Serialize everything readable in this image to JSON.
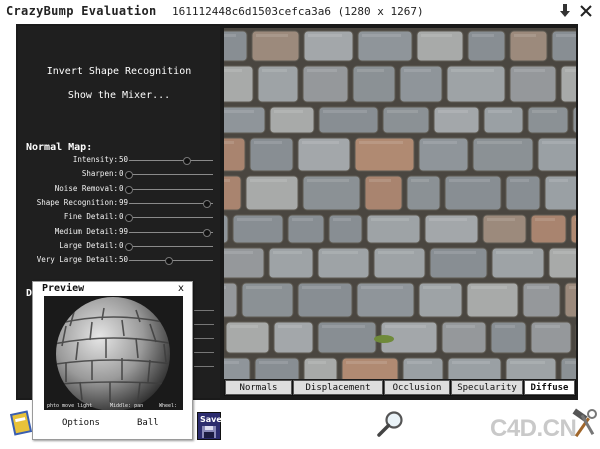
{
  "title_bar": {
    "app_title": "CrazyBump Evaluation",
    "file_info": "161112448c6d1503cefca3a6 (1280 x 1267)",
    "icons": [
      "download-arrow-icon",
      "close-icon"
    ]
  },
  "left_panel": {
    "commands": [
      "Invert Shape Recognition",
      "Show the Mixer..."
    ],
    "normal_map": {
      "heading": "Normal Map:",
      "sliders": [
        {
          "label": "Intensity:",
          "value": "50",
          "level": 0.72
        },
        {
          "label": "Sharpen:",
          "value": "0",
          "level": 0.0
        },
        {
          "label": "Noise Removal:",
          "value": "0",
          "level": 0.0
        },
        {
          "label": "Shape Recognition:",
          "value": "99",
          "level": 0.97
        },
        {
          "label": "Fine Detail:",
          "value": "0",
          "level": 0.0
        },
        {
          "label": "Medium Detail:",
          "value": "99",
          "level": 0.97
        },
        {
          "label": "Large Detail:",
          "value": "0",
          "level": 0.0
        },
        {
          "label": "Very Large Detail:",
          "value": "50",
          "level": 0.5
        }
      ]
    },
    "partial_heading": "D"
  },
  "tabs": [
    {
      "label": "Normals",
      "active": false
    },
    {
      "label": "Displacement",
      "active": false
    },
    {
      "label": "Occlusion",
      "active": false
    },
    {
      "label": "Specularity",
      "active": false
    },
    {
      "label": "Diffuse",
      "active": true
    }
  ],
  "preview": {
    "title": "Preview",
    "close": "x",
    "hints": [
      "phto move light",
      "Middle: pan",
      "Wheel:"
    ],
    "buttons": [
      "Options",
      "Ball"
    ]
  },
  "save_button": {
    "label": "Save"
  },
  "magnifier": {
    "icon": "magnifier-icon"
  },
  "tools": {
    "icon": "hammer-wrench-icon"
  },
  "watermark": "C4D.CN",
  "colors": {
    "panel": "#1f1f1f",
    "frame": "#1a1a1a",
    "active_tab": "#ffffff"
  }
}
